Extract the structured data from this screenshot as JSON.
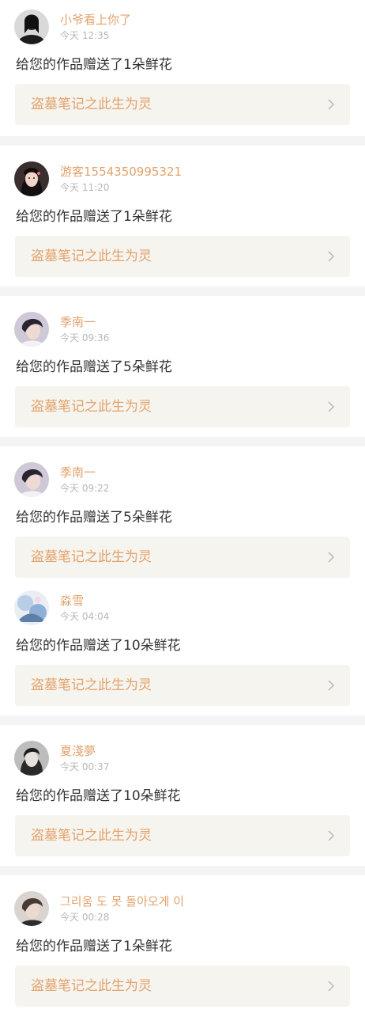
{
  "notifications": [
    {
      "username": "小爷看上你了",
      "time": "今天 12:35",
      "message": "给您的作品赠送了1朵鲜花",
      "work_title": "盗墓笔记之此生为灵",
      "avatar_icon": "user-avatar-dark-icon"
    },
    {
      "username": "游客1554350995321",
      "time": "今天 11:20",
      "message": "给您的作品赠送了1朵鲜花",
      "work_title": "盗墓笔记之此生为灵",
      "avatar_icon": "user-avatar-girl-icon"
    },
    {
      "username": "季南一",
      "time": "今天 09:36",
      "message": "给您的作品赠送了5朵鲜花",
      "work_title": "盗墓笔记之此生为灵",
      "avatar_icon": "user-avatar-boy-icon"
    },
    {
      "username": "季南一",
      "time": "今天 09:22",
      "message": "给您的作品赠送了5朵鲜花",
      "work_title": "盗墓笔记之此生为灵",
      "avatar_icon": "user-avatar-boy-icon"
    },
    {
      "username": "淼雪",
      "time": "今天 04:04",
      "message": "给您的作品赠送了10朵鲜花",
      "work_title": "盗墓笔记之此生为灵",
      "avatar_icon": "user-avatar-illustration-icon"
    },
    {
      "username": "夏淺夢",
      "time": "今天 00:37",
      "message": "给您的作品赠送了10朵鲜花",
      "work_title": "盗墓笔记之此生为灵",
      "avatar_icon": "user-avatar-girl-icon"
    },
    {
      "username": "그리움 도 못 돌아오게 이",
      "time": "今天 00:28",
      "message": "给您的作品赠送了1朵鲜花",
      "work_title": "盗墓笔记之此生为灵",
      "avatar_icon": "user-avatar-boy-icon"
    }
  ],
  "colors": {
    "accent": "#e2a26c",
    "time": "#b7b7b7",
    "message": "#333333",
    "card_bg": "#f6f4ee",
    "separator": "#f4f4f4"
  }
}
